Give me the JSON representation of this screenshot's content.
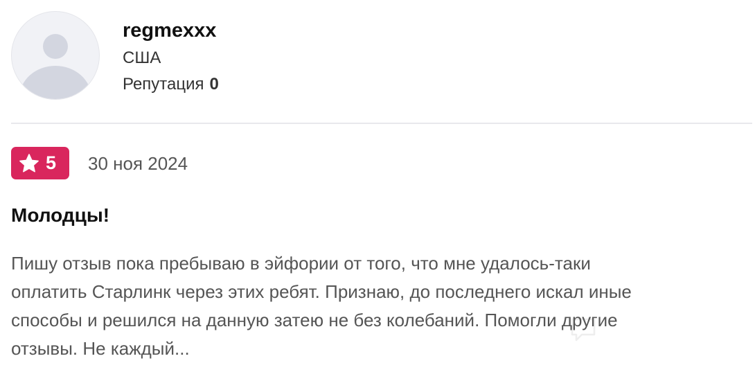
{
  "user": {
    "name": "regmexxx",
    "country": "США",
    "reputation_label": "Репутация",
    "reputation_value": "0"
  },
  "review": {
    "rating": "5",
    "date": "30 ноя 2024",
    "title": "Молодцы!",
    "text_lines": [
      "Пишу отзыв пока пребываю в эйфории от того, что мне удалось-таки",
      "оплатить Старлинк через этих ребят. Признаю, до последнего искал иные",
      "способы и решился на данную затею не без колебаний. Помогли другие",
      "отзывы. Не каждый..."
    ]
  },
  "icons": {
    "avatar": "user-avatar-placeholder-icon",
    "rating": "star-icon",
    "watermark": "chat-bubble-watermark-icon"
  },
  "colors": {
    "rating_badge": "#d9265d",
    "avatar_bg": "#f1f2f6",
    "avatar_figure": "#d3d6e0",
    "text_primary": "#111111",
    "text_secondary": "#555555",
    "divider": "#e8e8ec"
  }
}
